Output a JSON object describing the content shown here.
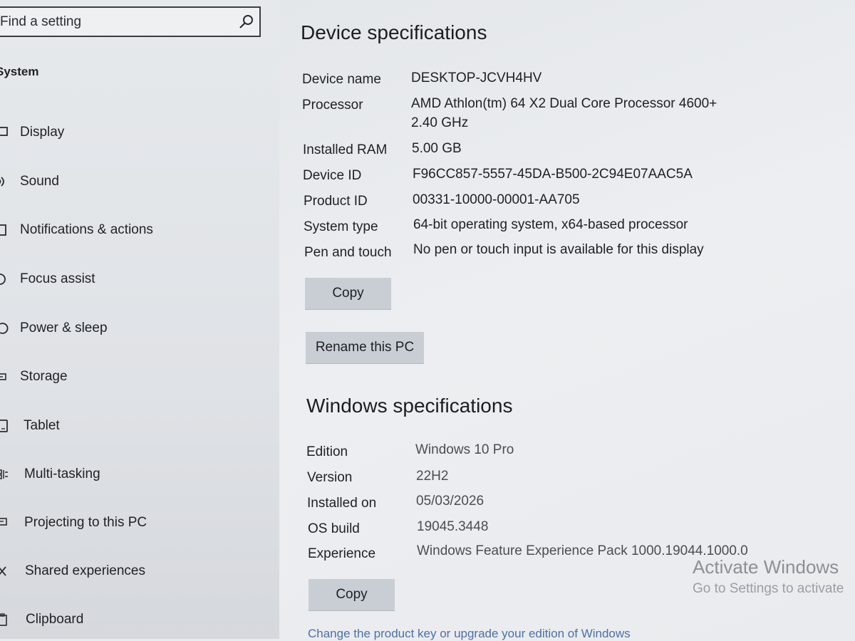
{
  "sidebar": {
    "search_placeholder": "Find a setting",
    "section_heading": "System",
    "items": [
      {
        "label": "Display",
        "icon": "monitor-icon"
      },
      {
        "label": "Sound",
        "icon": "speaker-icon"
      },
      {
        "label": "Notifications & actions",
        "icon": "notification-icon"
      },
      {
        "label": "Focus assist",
        "icon": "moon-icon"
      },
      {
        "label": "Power & sleep",
        "icon": "power-icon"
      },
      {
        "label": "Storage",
        "icon": "storage-icon"
      },
      {
        "label": "Tablet",
        "icon": "tablet-icon"
      },
      {
        "label": "Multi-tasking",
        "icon": "multitasking-icon"
      },
      {
        "label": "Projecting to this PC",
        "icon": "projector-icon"
      },
      {
        "label": "Shared experiences",
        "icon": "share-icon"
      },
      {
        "label": "Clipboard",
        "icon": "clipboard-icon"
      }
    ]
  },
  "device": {
    "heading": "Device specifications",
    "specs": [
      {
        "label": "Device name",
        "value": "DESKTOP-JCVH4HV"
      },
      {
        "label": "Processor",
        "value": "AMD Athlon(tm) 64 X2 Dual Core Processor 4600+",
        "value2": "2.40 GHz"
      },
      {
        "label": "Installed RAM",
        "value": "5.00 GB"
      },
      {
        "label": "Device ID",
        "value": "F96CC857-5557-45DA-B500-2C94E07AAC5A"
      },
      {
        "label": "Product ID",
        "value": "00331-10000-00001-AA705"
      },
      {
        "label": "System type",
        "value": "64-bit operating system, x64-based processor"
      },
      {
        "label": "Pen and touch",
        "value": "No pen or touch input is available for this display"
      }
    ],
    "copy_label": "Copy",
    "rename_label": "Rename this PC"
  },
  "windows": {
    "heading": "Windows specifications",
    "specs": [
      {
        "label": "Edition",
        "value": "Windows 10 Pro"
      },
      {
        "label": "Version",
        "value": "22H2"
      },
      {
        "label": "Installed on",
        "value": "05/03/2026"
      },
      {
        "label": "OS build",
        "value": "19045.3448"
      },
      {
        "label": "Experience",
        "value": "Windows Feature Experience Pack 1000.19044.1000.0"
      }
    ],
    "copy_label": "Copy",
    "product_key_link": "Change the product key or upgrade your edition of Windows"
  },
  "watermark": {
    "title": "Activate Windows",
    "subtitle": "Go to Settings to activate"
  }
}
